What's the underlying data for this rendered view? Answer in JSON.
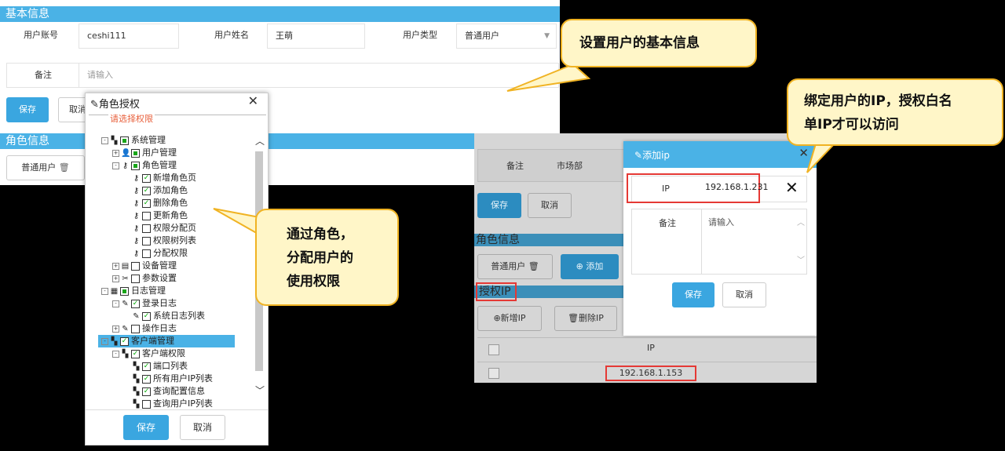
{
  "basic_info": {
    "title": "基本信息",
    "account_label": "用户账号",
    "account_value": "ceshi111",
    "name_label": "用户姓名",
    "name_value": "王萌",
    "type_label": "用户类型",
    "type_value": "普通用户",
    "remark_label": "备注",
    "remark_placeholder": "请输入",
    "save_label": "保存",
    "cancel_label": "取消"
  },
  "role_info": {
    "title": "角色信息",
    "role_tag": "普通用户"
  },
  "role_modal": {
    "title": "角色授权",
    "hint": "请选择权限",
    "save_label": "保存",
    "cancel_label": "取消",
    "tree": [
      {
        "label": "系统管理",
        "icon": "grid-icon",
        "check": "half",
        "expander": "-",
        "level": 0
      },
      {
        "label": "用户管理",
        "icon": "user-search-icon",
        "check": "half",
        "expander": "+",
        "level": 1
      },
      {
        "label": "角色管理",
        "icon": "user-key-icon",
        "check": "half",
        "expander": "-",
        "level": 1
      },
      {
        "label": "新增角色页",
        "icon": "user-key-icon",
        "check": "checked",
        "expander": "",
        "level": 2
      },
      {
        "label": "添加角色",
        "icon": "user-key-icon",
        "check": "checked",
        "expander": "",
        "level": 2
      },
      {
        "label": "删除角色",
        "icon": "user-key-icon",
        "check": "checked",
        "expander": "",
        "level": 2
      },
      {
        "label": "更新角色",
        "icon": "user-key-icon",
        "check": "empty",
        "expander": "",
        "level": 2
      },
      {
        "label": "权限分配页",
        "icon": "user-key-icon",
        "check": "empty",
        "expander": "",
        "level": 2
      },
      {
        "label": "权限树列表",
        "icon": "user-key-icon",
        "check": "empty",
        "expander": "",
        "level": 2
      },
      {
        "label": "分配权限",
        "icon": "user-key-icon",
        "check": "empty",
        "expander": "",
        "level": 2
      },
      {
        "label": "设备管理",
        "icon": "device-icon",
        "check": "empty",
        "expander": "+",
        "level": 1
      },
      {
        "label": "参数设置",
        "icon": "tools-icon",
        "check": "empty",
        "expander": "+",
        "level": 1
      },
      {
        "label": "日志管理",
        "icon": "log-icon",
        "check": "half",
        "expander": "-",
        "level": 0
      },
      {
        "label": "登录日志",
        "icon": "edit-log-icon",
        "check": "checked",
        "expander": "-",
        "level": 1
      },
      {
        "label": "系统日志列表",
        "icon": "edit-log-icon",
        "check": "checked",
        "expander": "",
        "level": 2
      },
      {
        "label": "操作日志",
        "icon": "edit-log-icon",
        "check": "empty",
        "expander": "+",
        "level": 1
      },
      {
        "label": "客户端管理",
        "icon": "grid-icon",
        "check": "checked",
        "expander": "-",
        "level": 0,
        "selected": true
      },
      {
        "label": "客户端权限",
        "icon": "grid-icon",
        "check": "checked",
        "expander": "-",
        "level": 1
      },
      {
        "label": "端口列表",
        "icon": "grid-icon",
        "check": "checked",
        "expander": "",
        "level": 2
      },
      {
        "label": "所有用户IP列表",
        "icon": "grid-icon",
        "check": "checked",
        "expander": "",
        "level": 2
      },
      {
        "label": "查询配置信息",
        "icon": "grid-icon",
        "check": "checked",
        "expander": "",
        "level": 2
      },
      {
        "label": "查询用户IP列表",
        "icon": "grid-icon",
        "check": "empty",
        "expander": "",
        "level": 2
      }
    ]
  },
  "panel2": {
    "remark_label": "备注",
    "remark_value": "市场部",
    "save_label": "保存",
    "cancel_label": "取消",
    "role_title": "角色信息",
    "role_tag": "普通用户",
    "add_label": "添加",
    "auth_ip_title": "授权IP",
    "new_ip_label": "新增IP",
    "delete_ip_label": "删除IP",
    "table_header_ip": "IP",
    "ip_row": "192.168.1.153"
  },
  "ip_modal": {
    "title": "添加ip",
    "ip_label": "IP",
    "ip_value": "192.168.1.231",
    "remark_label": "备注",
    "remark_placeholder": "请输入",
    "save_label": "保存",
    "cancel_label": "取消"
  },
  "callouts": {
    "basic": "设置用户的基本信息",
    "ip_line1": "绑定用户的IP，授权白名",
    "ip_line2": "单IP才可以访问",
    "role_line1": "通过角色，",
    "role_line2": "分配用户的",
    "role_line3": "使用权限"
  },
  "colors": {
    "header_blue": "#4ab2e6",
    "primary_button": "#3aa6e0",
    "callout_fill": "#fff6c8",
    "callout_border": "#f0b323",
    "highlight_red": "#e53935",
    "hint_red": "#e8603c"
  }
}
